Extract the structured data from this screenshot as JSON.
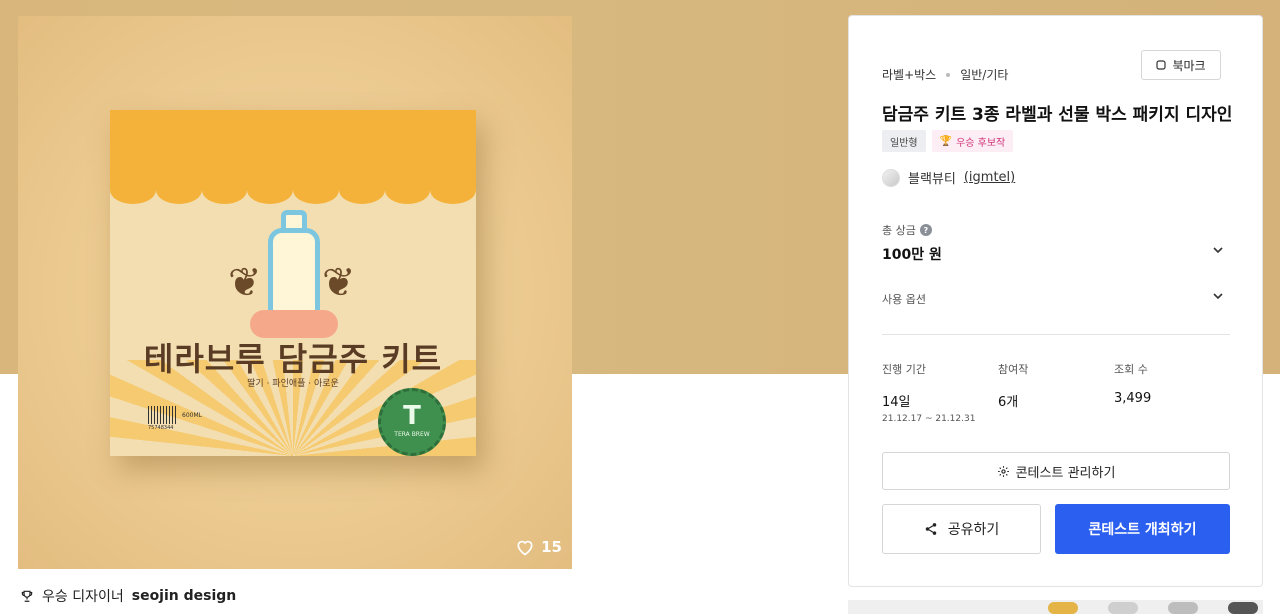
{
  "product": {
    "kit_title": "테라브루 담금주 키트",
    "kit_subtitle": "딸기 · 파인애플 · 아로운",
    "bottle_text": "TERA BREW",
    "barcode_number": "75748344",
    "volume": "600ML",
    "seal_letter": "T",
    "seal_text": "TERA BREW",
    "likes": "15"
  },
  "winner": {
    "label": "우승 디자이너",
    "name": "seojin design"
  },
  "card": {
    "category": "라벨+박스",
    "subcategory": "일반/기타",
    "bookmark_label": "북마크",
    "title": "담금주 키트 3종 라벨과 선물 박스 패키지 디자인",
    "badge_type": "일반형",
    "badge_candidate": "우승 후보작",
    "owner_name": "블랙뷰티",
    "owner_id": "(igmtel)",
    "prize_label": "총 상금",
    "prize_value": "100만 원",
    "usage_label": "사용 옵션",
    "stats": {
      "period_label": "진행 기간",
      "period_value": "14일",
      "period_range": "21.12.17 ~ 21.12.31",
      "entries_label": "참여작",
      "entries_value": "6개",
      "views_label": "조회 수",
      "views_value": "3,499"
    },
    "manage_label": "콘테스트 관리하기",
    "share_label": "공유하기",
    "host_label": "콘테스트 개최하기"
  },
  "colors": {
    "accent": "#2a5ff0",
    "background_band": "#d7b97f",
    "candidate_badge_text": "#d0347a"
  }
}
